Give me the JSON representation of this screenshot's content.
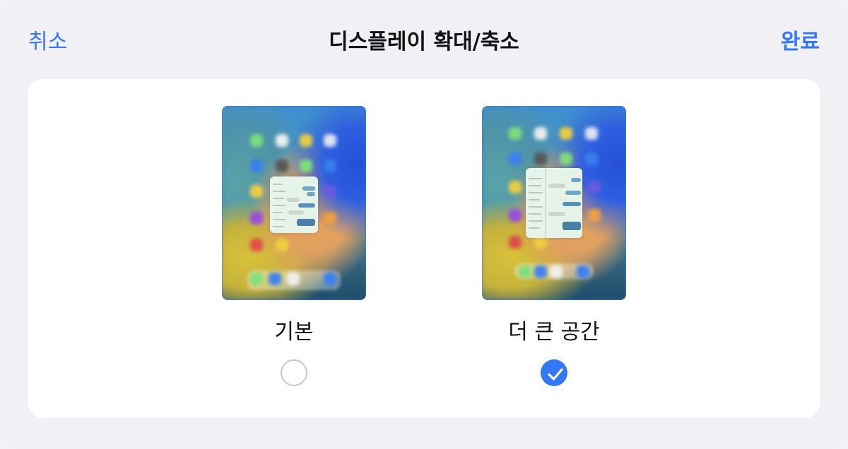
{
  "nav": {
    "cancel_label": "취소",
    "title": "디스플레이 확대/축소",
    "done_label": "완료"
  },
  "options": [
    {
      "label": "기본",
      "selected": false
    },
    {
      "label": "더 큰 공간",
      "selected": true
    }
  ],
  "colors": {
    "accent": "#3478f6",
    "background": "#f0f0f5",
    "card": "#ffffff",
    "radio_border": "#c7c7cc"
  },
  "icons": {
    "check": "checkmark-icon"
  }
}
